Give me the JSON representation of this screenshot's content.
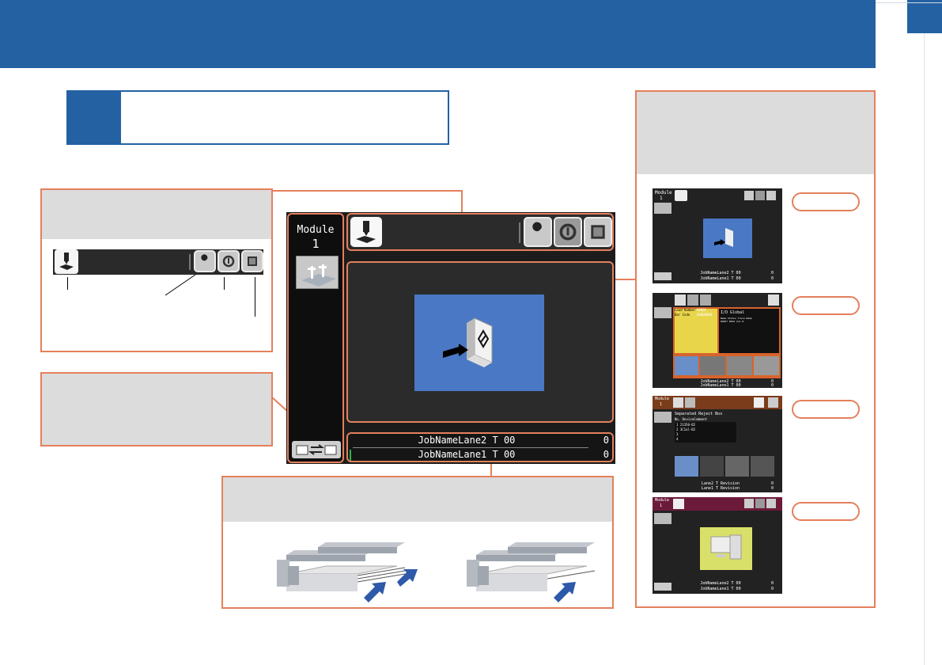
{
  "module_panel": {
    "label": "Module",
    "number": "1"
  },
  "status_bar": {
    "lane2_text": "JobNameLane2 T 00",
    "lane2_count": "0",
    "lane1_text": "JobNameLane1 T 00",
    "lane1_count": "0"
  },
  "thumbnails": {
    "t1": {
      "module_label": "Module",
      "module_number": "1",
      "lane2": "JobNameLane2 T 00",
      "lane1": "JobNameLane1 T 00",
      "count2": "0",
      "count1": "0"
    },
    "t2": {
      "field1_label": "Lead Number",
      "field1_value": "00001",
      "field2_label": "Bar Code",
      "field2_value": "00000000",
      "io_title": "I/O Global",
      "io_header": "Name   Status     Trace Name",
      "io_row": "DO027  0024  4/S 0:",
      "lane2": "JobNameLane2 T 00",
      "lane1": "JobNameLane1 T 00",
      "count2": "0",
      "count1": "0"
    },
    "t3": {
      "module_label": "Module",
      "module_number": "1",
      "heading": "Separated Reject Box",
      "col_header": "No.     DeviceComment",
      "rows": [
        "1  21350-B2",
        "2  3C1al-B2",
        "3",
        "4"
      ],
      "lane2": "Lane2 T Revision",
      "lane1": "Lane1 T Revision",
      "count2": "0",
      "count1": "0"
    },
    "t4": {
      "module_label": "Module",
      "module_number": "1",
      "lane2": "JobNameLane2 T 00",
      "lane1": "JobNameLane1 T 00",
      "count2": "0",
      "count1": "0"
    }
  },
  "icons": {
    "home": "mounting-head-icon",
    "tools": "wrench-icon",
    "sync": "sync-icon",
    "window": "window-icon",
    "lane_switch": "lane-switch-icon"
  },
  "colors": {
    "banner_blue": "#2361a3",
    "panel_orange": "#e4805c",
    "screen_blue": "#4a78c4",
    "thumb_header_brown": "#7a3c1a",
    "thumb_header_maroon": "#6c1a3a",
    "thumb_orange": "#d8632c"
  }
}
